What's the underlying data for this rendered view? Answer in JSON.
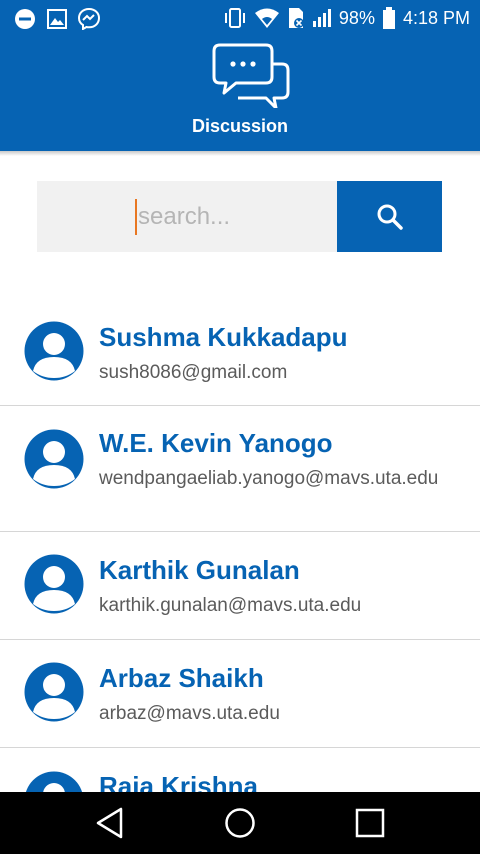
{
  "status_bar": {
    "battery": "98%",
    "time": "4:18 PM",
    "left_icons": [
      "do-not-disturb-icon",
      "image-icon",
      "messenger-icon"
    ],
    "right_icons": [
      "vibrate-icon",
      "wifi-icon",
      "sim-off-icon",
      "signal-icon",
      "battery-icon"
    ]
  },
  "header": {
    "icon": "chat-bubbles-icon",
    "title": "Discussion"
  },
  "search": {
    "placeholder": "search...",
    "button_icon": "search-icon"
  },
  "contacts": [
    {
      "name": "Sushma Kukkadapu",
      "email": "sush8086@gmail.com"
    },
    {
      "name": "W.E. Kevin Yanogo",
      "email": "wendpangaeliab.yanogo@mavs.uta.edu"
    },
    {
      "name": "Karthik Gunalan",
      "email": "karthik.gunalan@mavs.uta.edu"
    },
    {
      "name": "Arbaz Shaikh",
      "email": "arbaz@mavs.uta.edu"
    },
    {
      "name": "Raja Krishna",
      "email": ""
    }
  ],
  "nav_bar": {
    "buttons": [
      "back-icon",
      "home-icon",
      "recents-icon"
    ]
  },
  "colors": {
    "primary": "#0663b3",
    "caret": "#e87722",
    "search_field_bg": "#f1f1f1"
  }
}
